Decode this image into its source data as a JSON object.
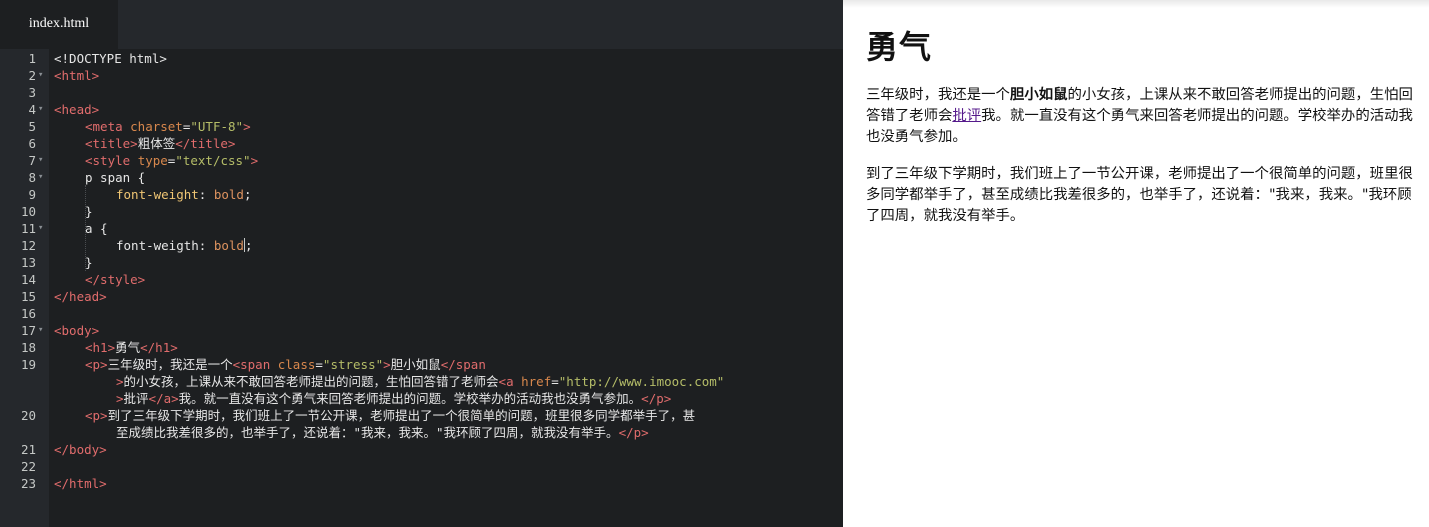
{
  "editor": {
    "tab_label": "index.html",
    "lines": [
      {
        "n": "1",
        "fold": "",
        "indent": 0,
        "segs": [
          [
            "w",
            "<!DOCTYPE html>"
          ]
        ]
      },
      {
        "n": "2",
        "fold": "▾",
        "indent": 0,
        "segs": [
          [
            "t",
            "<html>"
          ]
        ]
      },
      {
        "n": "3",
        "fold": "",
        "indent": 0,
        "segs": []
      },
      {
        "n": "4",
        "fold": "▾",
        "indent": 0,
        "segs": [
          [
            "t",
            "<head>"
          ]
        ]
      },
      {
        "n": "5",
        "fold": "",
        "indent": 1,
        "segs": [
          [
            "t",
            "<meta "
          ],
          [
            "at",
            "charset"
          ],
          [
            "w",
            "="
          ],
          [
            "s",
            "\"UTF-8\""
          ],
          [
            "t",
            ">"
          ]
        ]
      },
      {
        "n": "6",
        "fold": "",
        "indent": 1,
        "segs": [
          [
            "t",
            "<title>"
          ],
          [
            "w",
            "粗体签"
          ],
          [
            "t",
            "</title>"
          ]
        ]
      },
      {
        "n": "7",
        "fold": "▾",
        "indent": 1,
        "segs": [
          [
            "t",
            "<style "
          ],
          [
            "at",
            "type"
          ],
          [
            "w",
            "="
          ],
          [
            "s",
            "\"text/css\""
          ],
          [
            "t",
            ">"
          ]
        ]
      },
      {
        "n": "8",
        "fold": "▾",
        "indent": 1,
        "segs": [
          [
            "w",
            "p span {"
          ]
        ]
      },
      {
        "n": "9",
        "fold": "",
        "indent": 2,
        "segs": [
          [
            "p",
            "font-weight"
          ],
          [
            "w",
            ": "
          ],
          [
            "v",
            "bold"
          ],
          [
            "w",
            ";"
          ]
        ]
      },
      {
        "n": "10",
        "fold": "",
        "indent": 1,
        "segs": [
          [
            "w",
            "}"
          ]
        ]
      },
      {
        "n": "11",
        "fold": "▾",
        "indent": 1,
        "segs": [
          [
            "w",
            "a {"
          ]
        ]
      },
      {
        "n": "12",
        "fold": "",
        "indent": 2,
        "segs": [
          [
            "w",
            "font-weigth: "
          ],
          [
            "v",
            "bold"
          ],
          [
            "cursor",
            ""
          ],
          [
            "w",
            ";"
          ]
        ]
      },
      {
        "n": "13",
        "fold": "",
        "indent": 1,
        "segs": [
          [
            "w",
            "}"
          ]
        ]
      },
      {
        "n": "14",
        "fold": "",
        "indent": 1,
        "segs": [
          [
            "t",
            "</style>"
          ]
        ]
      },
      {
        "n": "15",
        "fold": "",
        "indent": 0,
        "segs": [
          [
            "t",
            "</head>"
          ]
        ]
      },
      {
        "n": "16",
        "fold": "",
        "indent": 0,
        "segs": []
      },
      {
        "n": "17",
        "fold": "▾",
        "indent": 0,
        "segs": [
          [
            "t",
            "<body>"
          ]
        ]
      },
      {
        "n": "18",
        "fold": "",
        "indent": 1,
        "segs": [
          [
            "t",
            "<h1>"
          ],
          [
            "w",
            "勇气"
          ],
          [
            "t",
            "</h1>"
          ]
        ]
      },
      {
        "n": "19",
        "fold": "",
        "indent": 1,
        "segs": [
          [
            "t",
            "<p>"
          ],
          [
            "w",
            "三年级时，我还是一个"
          ],
          [
            "t",
            "<span "
          ],
          [
            "at",
            "class"
          ],
          [
            "w",
            "="
          ],
          [
            "s",
            "\"stress\""
          ],
          [
            "t",
            ">"
          ],
          [
            "w",
            "胆小如鼠"
          ],
          [
            "t",
            "</span"
          ]
        ]
      },
      {
        "n": "",
        "fold": "",
        "indent": 2,
        "segs": [
          [
            "t",
            ">"
          ],
          [
            "w",
            "的小女孩，上课从来不敢回答老师提出的问题，生怕回答错了老师会"
          ],
          [
            "t",
            "<a "
          ],
          [
            "at",
            "href"
          ],
          [
            "w",
            "="
          ],
          [
            "s",
            "\"http://www.imooc.com\""
          ]
        ]
      },
      {
        "n": "",
        "fold": "",
        "indent": 2,
        "segs": [
          [
            "t",
            ">"
          ],
          [
            "w",
            "批评"
          ],
          [
            "t",
            "</a>"
          ],
          [
            "w",
            "我。就一直没有这个勇气来回答老师提出的问题。学校举办的活动我也没勇气参加。"
          ],
          [
            "t",
            "</p>"
          ]
        ]
      },
      {
        "n": "20",
        "fold": "",
        "indent": 1,
        "segs": [
          [
            "t",
            "<p>"
          ],
          [
            "w",
            "到了三年级下学期时，我们班上了一节公开课，老师提出了一个很简单的问题，班里很多同学都举手了，甚"
          ]
        ]
      },
      {
        "n": "",
        "fold": "",
        "indent": 2,
        "segs": [
          [
            "w",
            "至成绩比我差很多的，也举手了，还说着：\"我来，我来。\"我环顾了四周，就我没有举手。"
          ],
          [
            "t",
            "</p>"
          ]
        ]
      },
      {
        "n": "21",
        "fold": "",
        "indent": 0,
        "segs": [
          [
            "t",
            "</body>"
          ]
        ]
      },
      {
        "n": "22",
        "fold": "",
        "indent": 0,
        "segs": []
      },
      {
        "n": "23",
        "fold": "",
        "indent": 0,
        "segs": [
          [
            "t",
            "</html>"
          ]
        ]
      }
    ]
  },
  "preview": {
    "heading": "勇气",
    "p1": {
      "before": "三年级时，我还是一个",
      "stress": "胆小如鼠",
      "middle": "的小女孩，上课从来不敢回答老师提出的问题，生怕回答错了老师会",
      "link": "批评",
      "after": "我。就一直没有这个勇气来回答老师提出的问题。学校举办的活动我也没勇气参加。"
    },
    "p2": "到了三年级下学期时，我们班上了一节公开课，老师提出了一个很简单的问题，班里很多同学都举手了，甚至成绩比我差很多的，也举手了，还说着：\"我来，我来。\"我环顾了四周，就我没有举手。"
  }
}
